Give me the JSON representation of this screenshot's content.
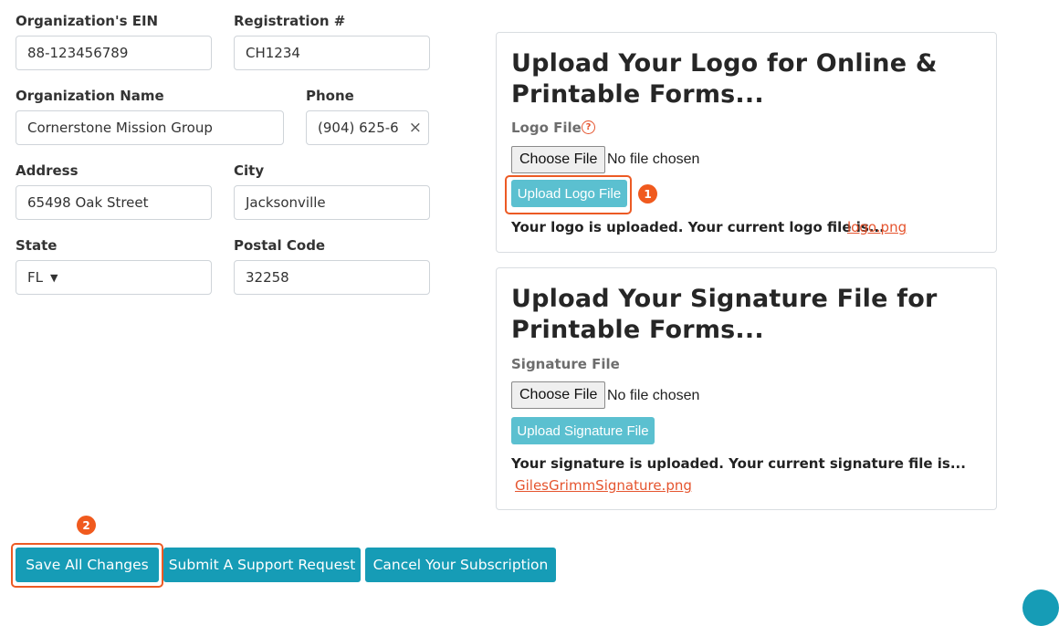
{
  "form": {
    "ein": {
      "label": "Organization's EIN",
      "value": "88-123456789"
    },
    "registration": {
      "label": "Registration #",
      "value": "CH1234"
    },
    "org_name": {
      "label": "Organization Name",
      "value": "Cornerstone Mission Group"
    },
    "phone": {
      "label": "Phone",
      "value": "(904) 625-6",
      "clear_glyph": "×"
    },
    "address": {
      "label": "Address",
      "value": "65498 Oak Street"
    },
    "city": {
      "label": "City",
      "value": "Jacksonville"
    },
    "state": {
      "label": "State",
      "value": "FL",
      "caret": "▼"
    },
    "postal": {
      "label": "Postal Code",
      "value": "32258"
    }
  },
  "logo_panel": {
    "title_line1": "Upload Your Logo for Online &",
    "title_line2": "Printable Forms...",
    "field_label": "Logo File",
    "help_glyph": "?",
    "choose_label": "Choose File",
    "no_file": "No file chosen",
    "upload_label": "Upload Logo File",
    "status_text": "Your logo is uploaded. Your current logo file is...",
    "file_link": "logo.png"
  },
  "signature_panel": {
    "title_line1": "Upload Your Signature File for",
    "title_line2": "Printable Forms...",
    "field_label": "Signature File",
    "choose_label": "Choose File",
    "no_file": "No file chosen",
    "upload_label": "Upload Signature File",
    "status_text": "Your signature is uploaded. Your current signature file is...",
    "file_link": "GilesGrimmSignature.png"
  },
  "actions": {
    "save": "Save All Changes",
    "support": "Submit A Support Request",
    "cancel": "Cancel Your Subscription"
  },
  "markers": {
    "one": "1",
    "two": "2"
  },
  "colors": {
    "primary": "#169cb6",
    "upload": "#5bc0d0",
    "highlight": "#ec5a24",
    "link": "#e5542e"
  },
  "icons": {
    "help": "question-circle-icon",
    "clear": "close-icon",
    "caret": "caret-down-icon"
  }
}
